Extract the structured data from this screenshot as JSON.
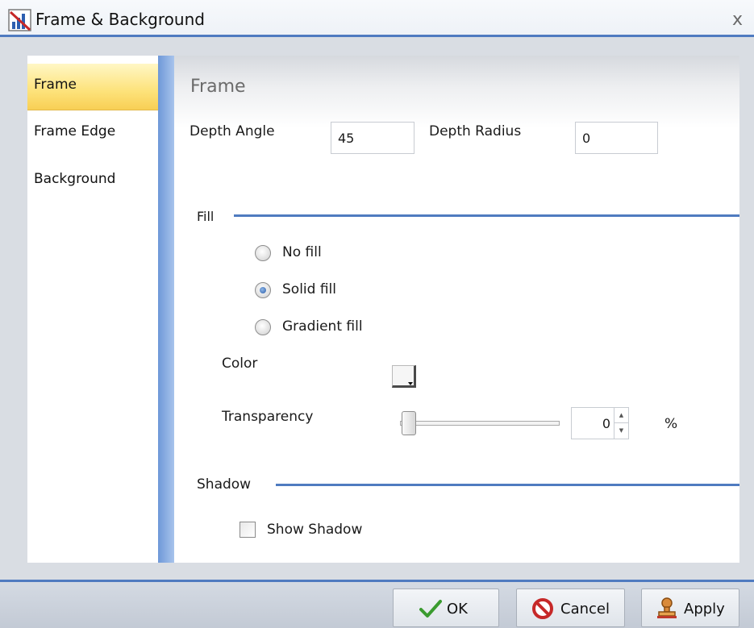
{
  "window": {
    "title": "Frame & Background",
    "close_glyph": "x",
    "app_icon": "chart-icon"
  },
  "nav": {
    "items": [
      {
        "label": "Frame",
        "active": true
      },
      {
        "label": "Frame Edge",
        "active": false
      },
      {
        "label": "Background",
        "active": false
      }
    ]
  },
  "frame": {
    "title": "Frame",
    "depth_angle_label": "Depth Angle",
    "depth_angle_value": "45",
    "depth_radius_label": "Depth Radius",
    "depth_radius_value": "0"
  },
  "fill": {
    "section_label": "Fill",
    "options": [
      {
        "label": "No fill",
        "checked": false
      },
      {
        "label": "Solid fill",
        "checked": true
      },
      {
        "label": "Gradient fill",
        "checked": false
      }
    ],
    "color_label": "Color",
    "color_value": "#f6f6f6",
    "transparency_label": "Transparency",
    "transparency_value": "0",
    "transparency_unit": "%",
    "transparency_level": 0
  },
  "shadow": {
    "section_label": "Shadow",
    "show_shadow_label": "Show Shadow",
    "show_shadow_checked": false
  },
  "buttons": {
    "ok": "OK",
    "cancel": "Cancel",
    "apply": "Apply"
  },
  "colors": {
    "accent": "#4f7bc0",
    "active_tab": "#fde27a",
    "ok_icon": "#3a9b2f",
    "cancel_icon": "#c62828"
  }
}
